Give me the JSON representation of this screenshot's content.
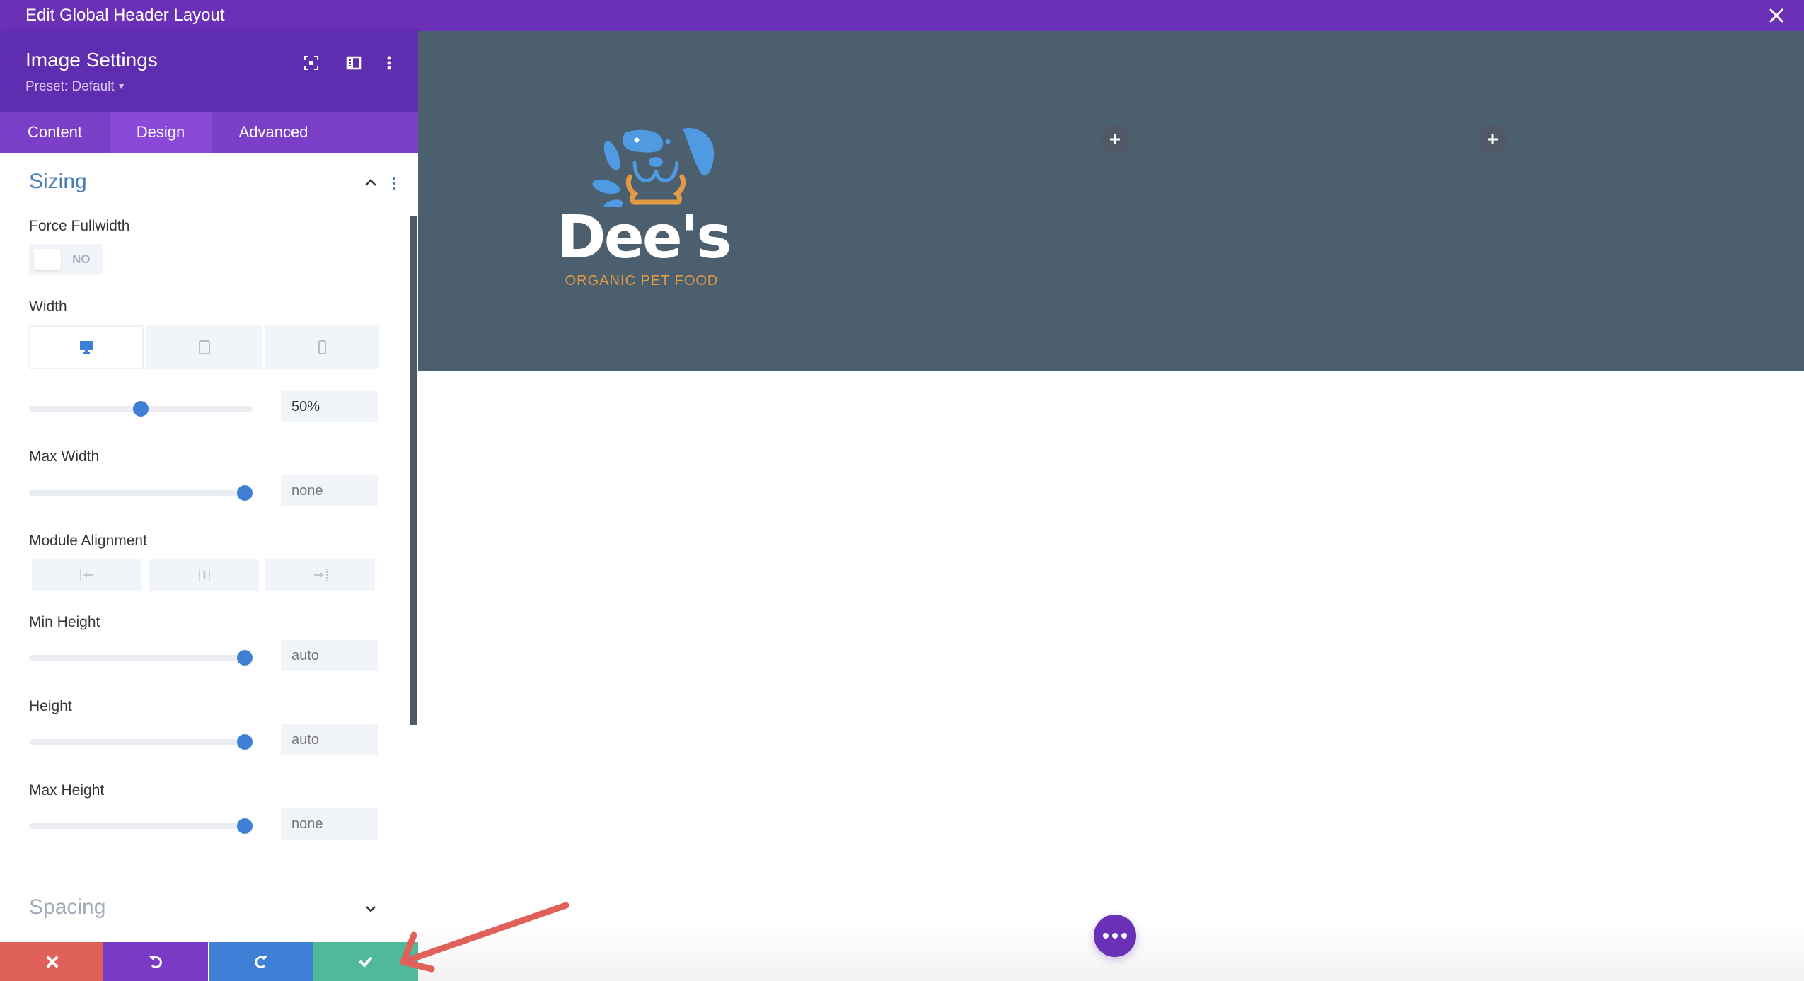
{
  "window": {
    "title": "Edit Global Header Layout",
    "close_icon": "close-icon"
  },
  "panel": {
    "title": "Image Settings",
    "preset_label": "Preset: Default",
    "header_icons": [
      "fullscreen-icon",
      "sidebar-layout-icon",
      "more-vertical-icon"
    ],
    "tabs": [
      {
        "label": "Content",
        "active": false
      },
      {
        "label": "Design",
        "active": true
      },
      {
        "label": "Advanced",
        "active": false
      }
    ],
    "sections": {
      "sizing": {
        "title": "Sizing",
        "expanded": true,
        "force_fullwidth": {
          "label": "Force Fullwidth",
          "value": "NO"
        },
        "width": {
          "label": "Width",
          "devices": [
            "desktop",
            "tablet",
            "phone"
          ],
          "active_device": "desktop",
          "value": "50%",
          "slider_fraction": 0.5
        },
        "max_width": {
          "label": "Max Width",
          "value": "none",
          "slider_fraction": 0.97
        },
        "module_alignment": {
          "label": "Module Alignment",
          "options": [
            "left",
            "center",
            "right"
          ]
        },
        "min_height": {
          "label": "Min Height",
          "value": "auto",
          "slider_fraction": 0.97
        },
        "height": {
          "label": "Height",
          "value": "auto",
          "slider_fraction": 0.97
        },
        "max_height": {
          "label": "Max Height",
          "value": "none",
          "slider_fraction": 0.97
        }
      },
      "spacing": {
        "title": "Spacing",
        "expanded": false
      }
    },
    "bottom_actions": [
      {
        "name": "discard",
        "icon": "close-icon",
        "color": "#e0605a"
      },
      {
        "name": "undo",
        "icon": "undo-icon",
        "color": "#7b3ac6"
      },
      {
        "name": "redo",
        "icon": "redo-icon",
        "color": "#3f7fd6"
      },
      {
        "name": "save",
        "icon": "check-icon",
        "color": "#4fb99a"
      }
    ]
  },
  "canvas": {
    "logo": {
      "name": "Dee's",
      "tagline": "ORGANIC PET FOOD"
    },
    "header_bg": "#4b5f6f"
  },
  "colors": {
    "topbar": "#6a30b6",
    "accent_blue": "#3f7fd6",
    "tab_active": "#8a49d8"
  }
}
